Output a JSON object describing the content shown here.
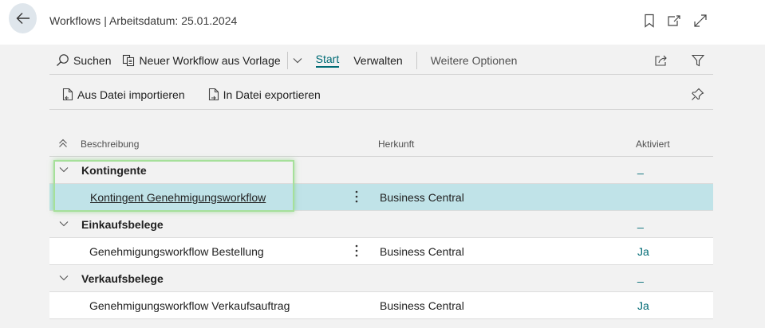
{
  "header": {
    "title": "Workflows | Arbeitsdatum: 25.01.2024"
  },
  "toolbar": {
    "search_label": "Suchen",
    "new_from_template_label": "Neuer Workflow aus Vorlage",
    "tab_start_label": "Start",
    "tab_manage_label": "Verwalten",
    "more_options_label": "Weitere Optionen",
    "import_label": "Aus Datei importieren",
    "export_label": "In Datei exportieren"
  },
  "table": {
    "columns": {
      "description": "Beschreibung",
      "origin": "Herkunft",
      "enabled": "Aktiviert"
    },
    "groups": [
      {
        "label": "Kontingente",
        "enabled": "_",
        "rows": [
          {
            "description": "Kontingent Genehmigungsworkflow",
            "origin": "Business Central",
            "enabled": ""
          }
        ]
      },
      {
        "label": "Einkaufsbelege",
        "enabled": "_",
        "rows": [
          {
            "description": "Genehmigungsworkflow Bestellung",
            "origin": "Business Central",
            "enabled": "Ja"
          }
        ]
      },
      {
        "label": "Verkaufsbelege",
        "enabled": "_",
        "rows": [
          {
            "description": "Genehmigungsworkflow Verkaufsauftrag",
            "origin": "Business Central",
            "enabled": "Ja"
          }
        ]
      }
    ]
  },
  "colors": {
    "accent": "#006b75",
    "selected_row": "#c0e3e8",
    "focus_outline": "#a6e09a"
  }
}
